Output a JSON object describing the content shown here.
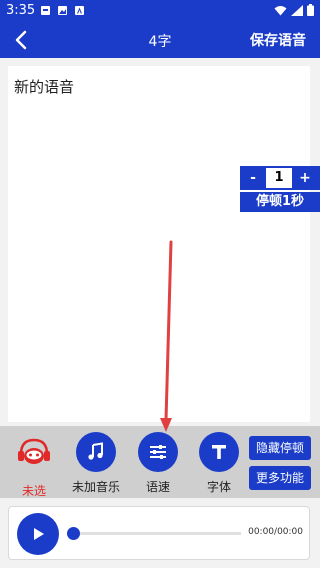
{
  "status_bar": {
    "time": "3:35"
  },
  "app_bar": {
    "title": "4字",
    "save_label": "保存语音"
  },
  "editor": {
    "text": "新的语音"
  },
  "pause_control": {
    "minus_label": "-",
    "value": "1",
    "plus_label": "+",
    "label": "停顿1秒"
  },
  "toolbar": {
    "voice_label": "未选",
    "music_label": "未加音乐",
    "speed_label": "语速",
    "font_label": "字体",
    "hide_pause_label": "隐藏停顿",
    "more_label": "更多功能"
  },
  "player": {
    "time": "00:00/00:00",
    "progress": 0
  },
  "colors": {
    "primary": "#1a3cc8",
    "annotation": "#e04040",
    "unselected": "#e02a2a"
  }
}
